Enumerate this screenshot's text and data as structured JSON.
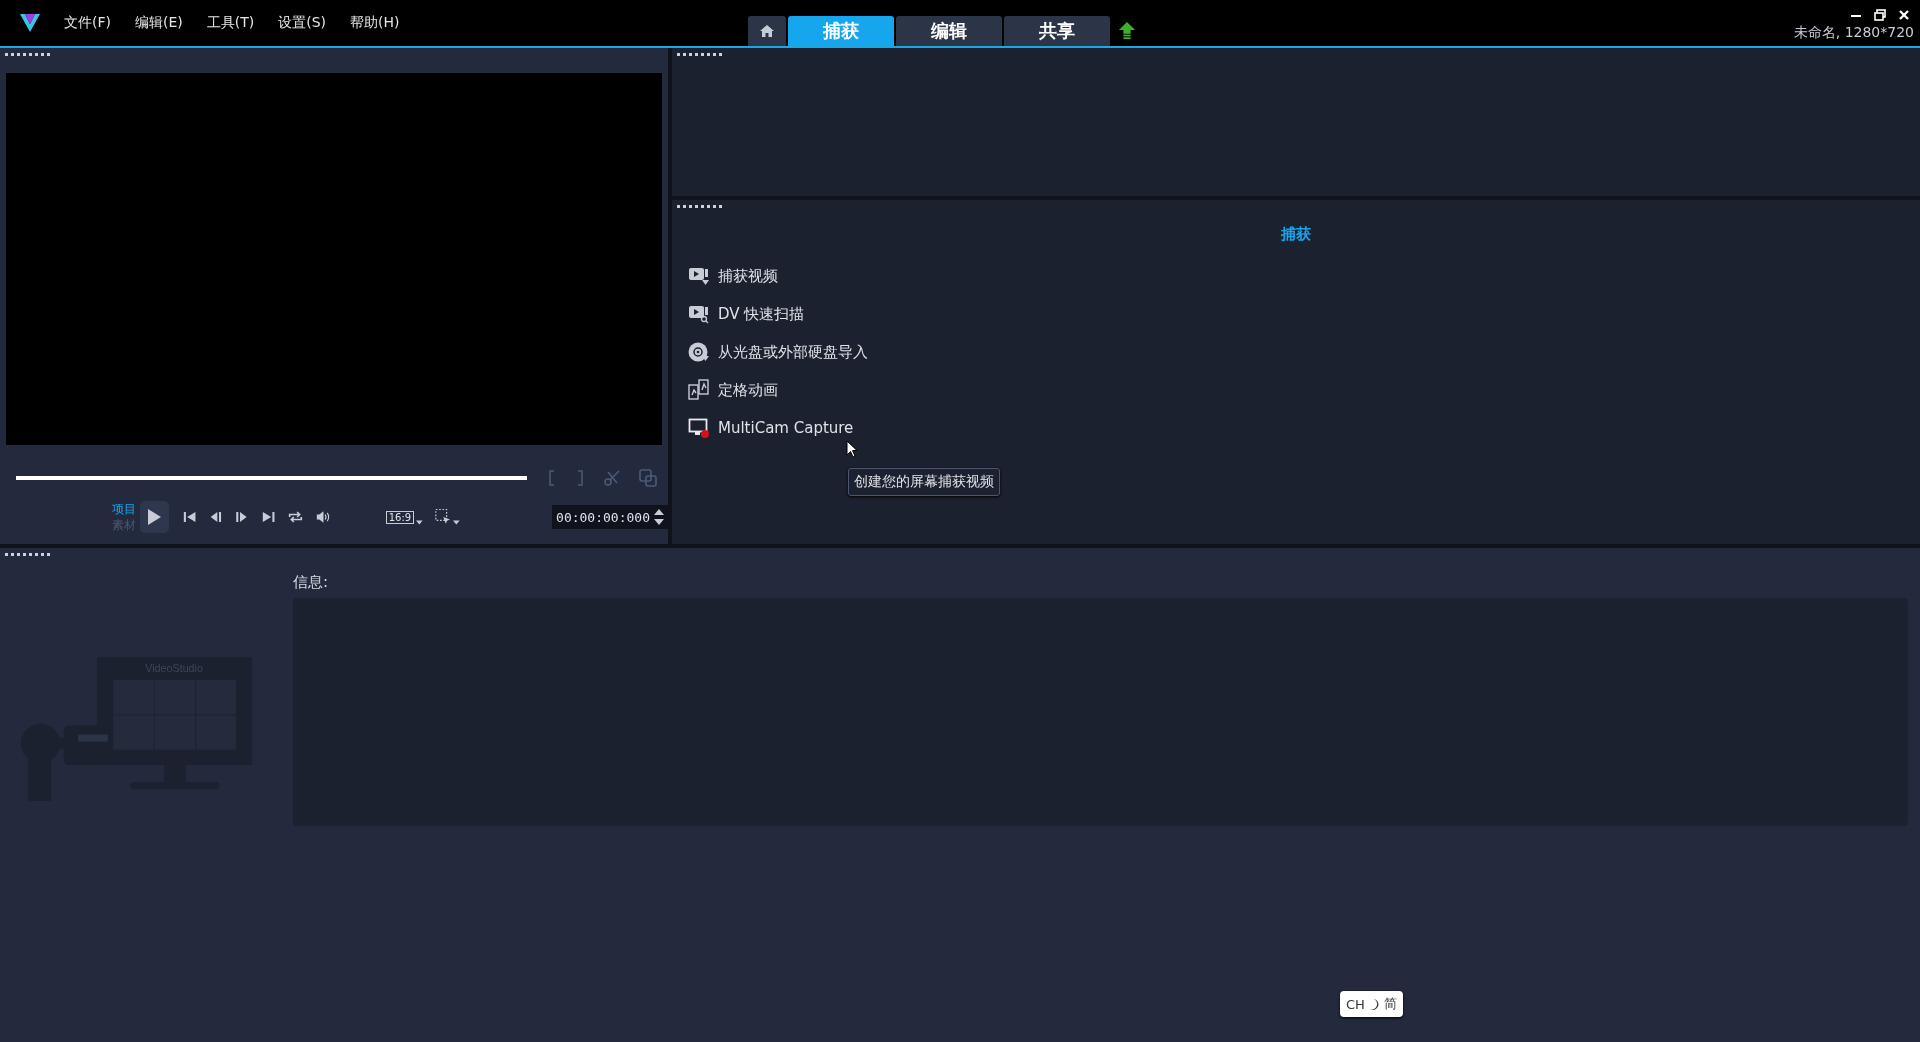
{
  "menu": [
    "文件(F)",
    "编辑(E)",
    "工具(T)",
    "设置(S)",
    "帮助(H)"
  ],
  "tabs": [
    {
      "kind": "home",
      "selected": false
    },
    {
      "kind": "text",
      "label": "捕获",
      "selected": true
    },
    {
      "kind": "text",
      "label": "编辑",
      "selected": false
    },
    {
      "kind": "text",
      "label": "共享",
      "selected": false
    },
    {
      "kind": "upload",
      "selected": false
    }
  ],
  "project_info": "未命名, 1280*720",
  "player": {
    "mode_toggle": [
      {
        "label": "项目",
        "selected": true
      },
      {
        "label": "素材",
        "selected": false
      }
    ],
    "aspect": "16:9",
    "timecode": "00:00:00:000"
  },
  "capture": {
    "title": "捕获",
    "items": [
      {
        "kind": "video",
        "label": "捕获视频"
      },
      {
        "kind": "scan",
        "label": "DV 快速扫描"
      },
      {
        "kind": "disc",
        "label": "从光盘或外部硬盘导入"
      },
      {
        "kind": "stopmotion",
        "label": "定格动画"
      },
      {
        "kind": "screen",
        "label": "MultiCam Capture"
      }
    ],
    "tooltip": "创建您的屏幕捕获视频"
  },
  "info": {
    "label": "信息:",
    "illustration_title": "VideoStudio"
  },
  "ime": {
    "lang": "CH",
    "mode": "简"
  }
}
